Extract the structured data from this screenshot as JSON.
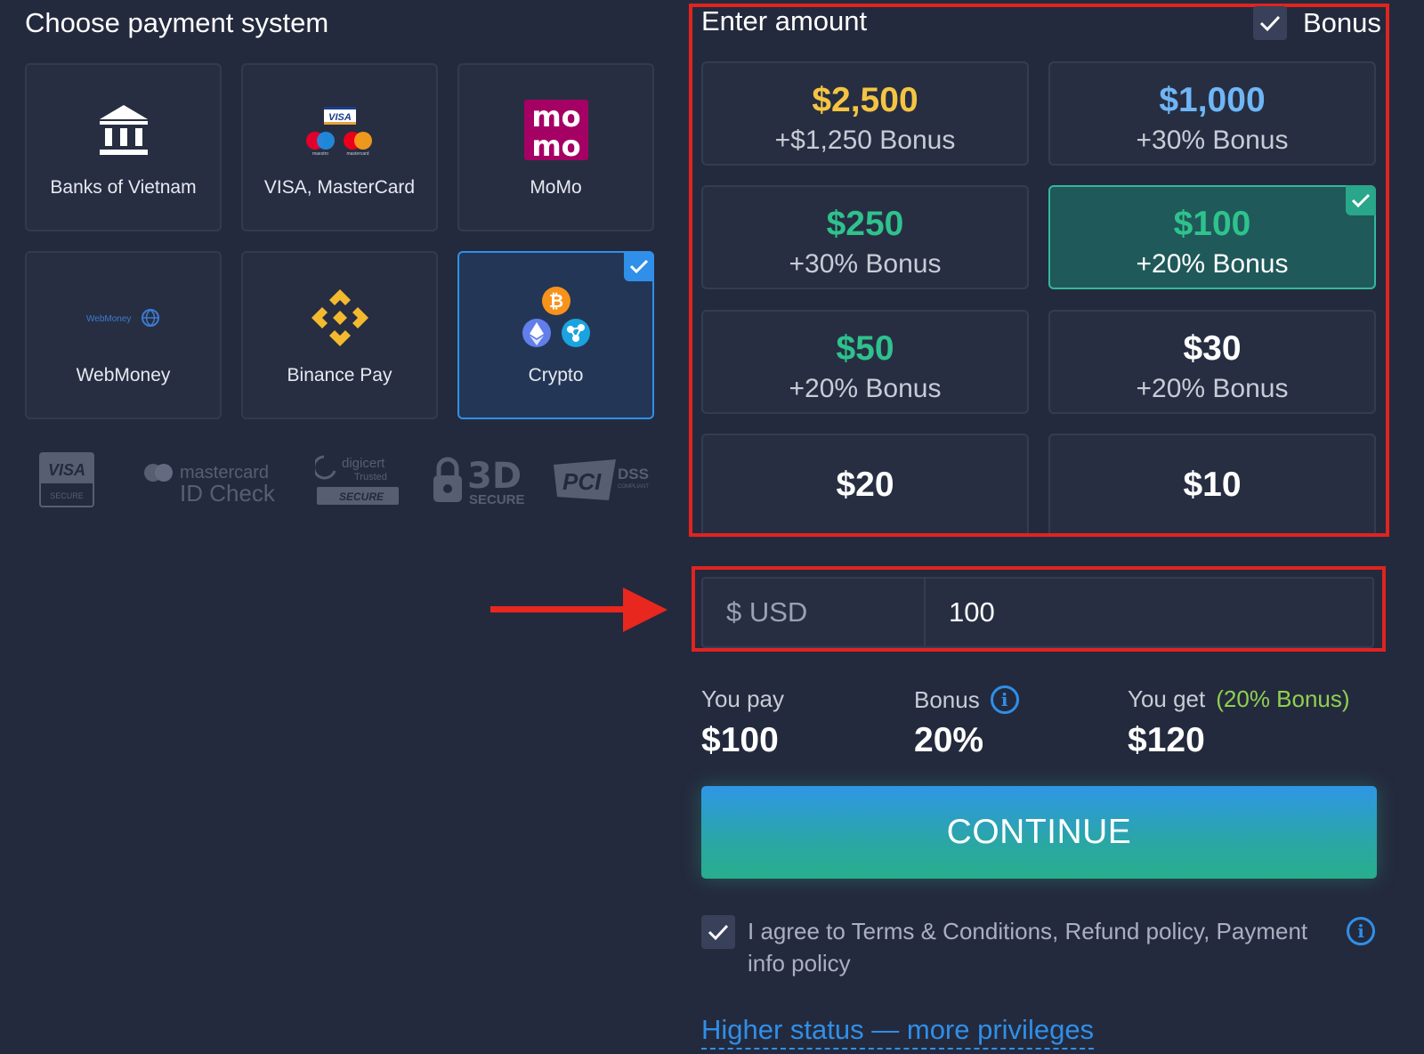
{
  "payment": {
    "title": "Choose payment system",
    "methods": [
      {
        "label": "Banks of Vietnam"
      },
      {
        "label": "VISA, MasterCard",
        "visa_text": "VISA",
        "maestro_text": "maestro",
        "mastercard_text": "mastercard"
      },
      {
        "label": "MoMo",
        "logo_line1": "mo",
        "logo_line2": "mo"
      },
      {
        "label": "WebMoney",
        "logo_text": "WebMoney"
      },
      {
        "label": "Binance Pay"
      },
      {
        "label": "Crypto",
        "selected": true
      }
    ],
    "security_logos": {
      "visa": "VISA",
      "visa_sub": "SECURE",
      "mc_line1": "mastercard",
      "mc_line2": "ID Check",
      "digicert_line1": "digicert",
      "digicert_line2": "Trusted",
      "digicert_badge": "SECURE",
      "threed": "3D",
      "threed_sub": "SECURE",
      "pci": "PCI",
      "dss": "DSS",
      "pci_sub": "COMPLIANT"
    }
  },
  "amount": {
    "title": "Enter amount",
    "bonus_label": "Bonus",
    "bonus_checked": true,
    "options": [
      {
        "value": "$2,500",
        "bonus": "+$1,250 Bonus",
        "color": "#f5c542"
      },
      {
        "value": "$1,000",
        "bonus": "+30% Bonus",
        "color": "#6fb6f7"
      },
      {
        "value": "$250",
        "bonus": "+30% Bonus",
        "color": "#2ec28d"
      },
      {
        "value": "$100",
        "bonus": "+20% Bonus",
        "color": "#2ec28d",
        "selected": true
      },
      {
        "value": "$50",
        "bonus": "+20% Bonus",
        "color": "#2ec28d"
      },
      {
        "value": "$30",
        "bonus": "+20% Bonus",
        "color": "#ffffff"
      },
      {
        "value": "$20",
        "bonus": "",
        "color": "#ffffff"
      },
      {
        "value": "$10",
        "bonus": "",
        "color": "#ffffff"
      }
    ],
    "currency_label": "$ USD",
    "input_value": "100"
  },
  "summary": {
    "you_pay_label": "You pay",
    "you_pay_value": "$100",
    "bonus_label": "Bonus",
    "bonus_value": "20%",
    "you_get_label": "You get",
    "you_get_bonus": "(20% Bonus)",
    "you_get_value": "$120"
  },
  "actions": {
    "continue_label": "CONTINUE",
    "agree_text": "I agree to Terms & Conditions, Refund policy, Payment info policy",
    "higher_status": "Higher status — more privileges"
  },
  "colors": {
    "background": "#242a3d",
    "accent_blue": "#2f8fe9",
    "accent_teal": "#2aa68a",
    "annotation_red": "#e0241f",
    "bonus_green": "#8fd14f"
  }
}
